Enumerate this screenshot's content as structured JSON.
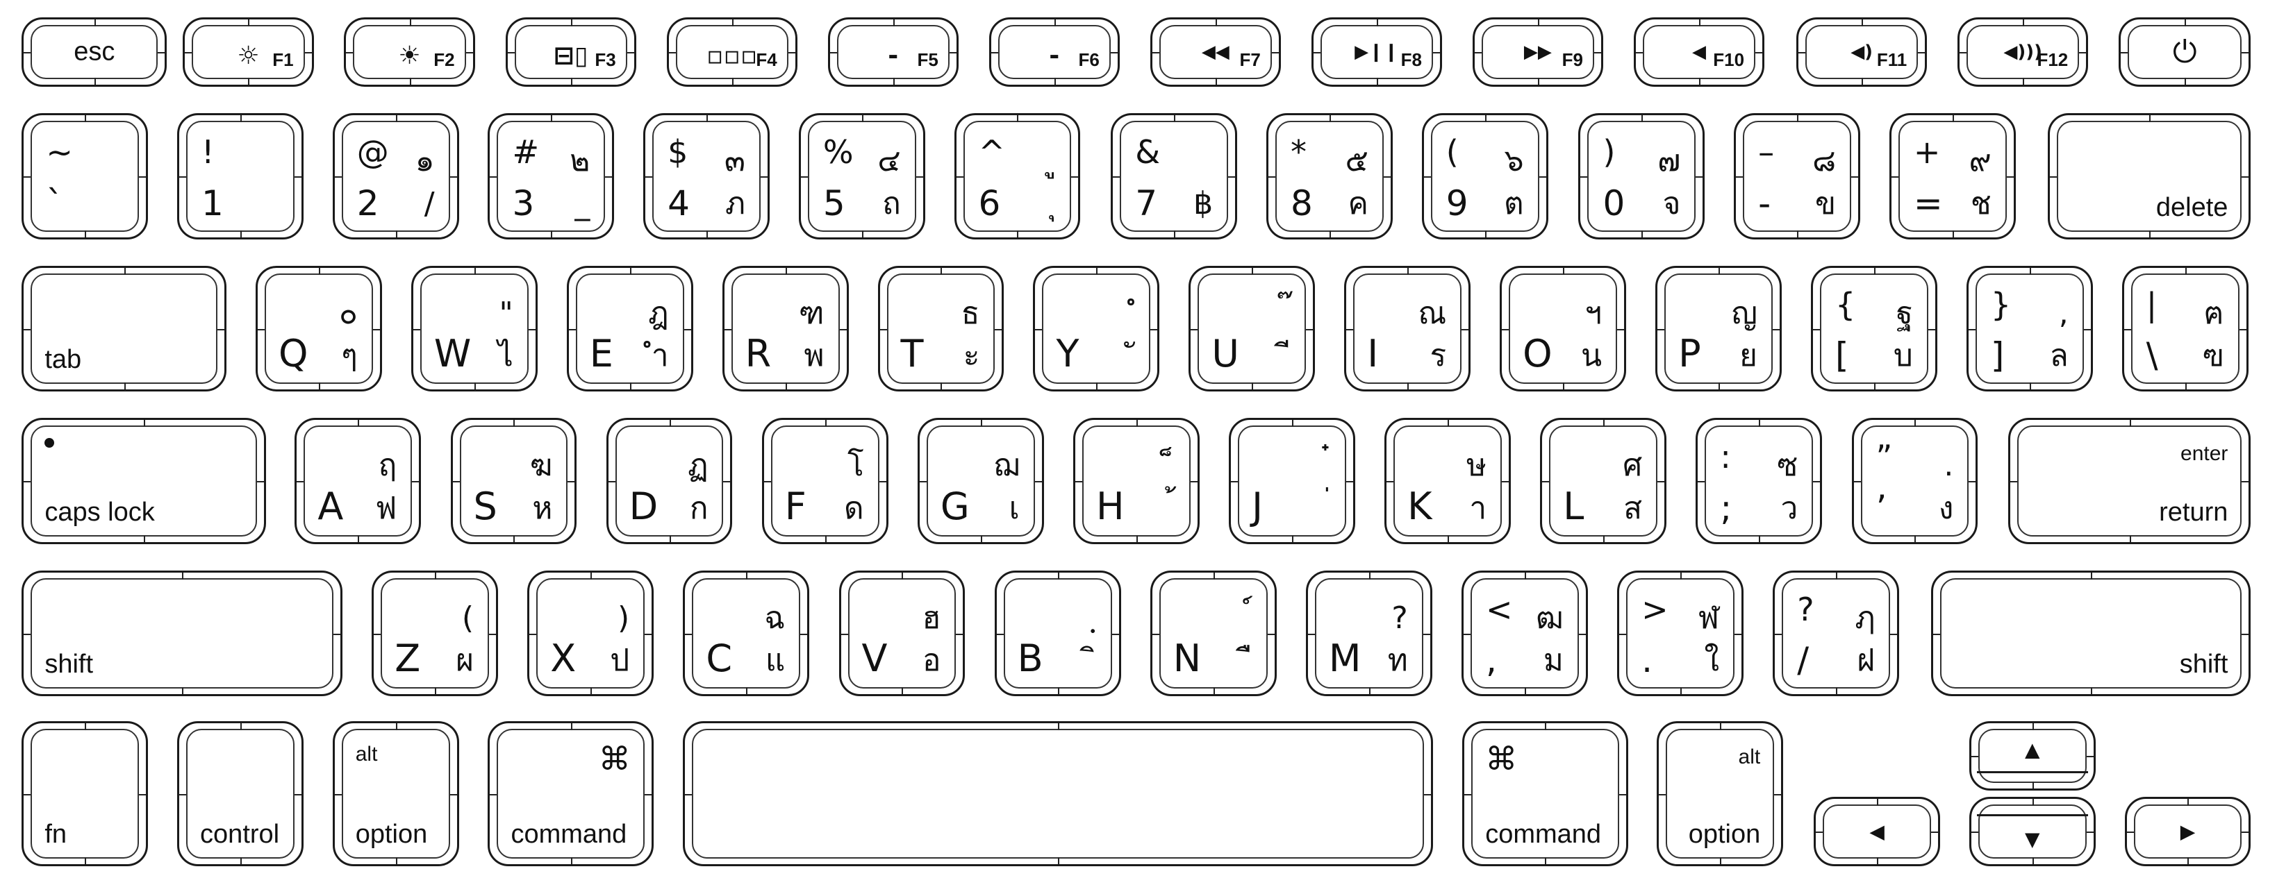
{
  "keyboard": {
    "layout_name": "Thai Kedmanee on Apple keyboard",
    "function_row": [
      {
        "id": "esc",
        "label": "esc"
      },
      {
        "id": "f1",
        "icon": "brightness-down-icon",
        "glyph": "☼",
        "fn": "F1"
      },
      {
        "id": "f2",
        "icon": "brightness-up-icon",
        "glyph": "☀",
        "fn": "F2"
      },
      {
        "id": "f3",
        "icon": "mission-control-icon",
        "glyph": "⊟▯",
        "fn": "F3"
      },
      {
        "id": "f4",
        "icon": "launchpad-grid-icon",
        "glyph": "▫▫▫",
        "fn": "F4"
      },
      {
        "id": "f5",
        "icon": "keyboard-backlight-down-icon",
        "glyph": "⁃",
        "fn": "F5"
      },
      {
        "id": "f6",
        "icon": "keyboard-backlight-up-icon",
        "glyph": "⁃",
        "fn": "F6"
      },
      {
        "id": "f7",
        "icon": "rewind-icon",
        "glyph": "◀◀",
        "fn": "F7"
      },
      {
        "id": "f8",
        "icon": "play-pause-icon",
        "glyph": "▶❙❙",
        "fn": "F8"
      },
      {
        "id": "f9",
        "icon": "fast-forward-icon",
        "glyph": "▶▶",
        "fn": "F9"
      },
      {
        "id": "f10",
        "icon": "mute-icon",
        "glyph": "◀",
        "fn": "F10"
      },
      {
        "id": "f11",
        "icon": "volume-down-icon",
        "glyph": "◀)",
        "fn": "F11"
      },
      {
        "id": "f12",
        "icon": "volume-up-icon",
        "glyph": "◀)))",
        "fn": "F12"
      },
      {
        "id": "power",
        "icon": "power-icon",
        "glyph": "⏻"
      }
    ],
    "number_row": [
      {
        "id": "grave",
        "shift": "~",
        "base": "`",
        "thai_shift": "",
        "thai_base": ""
      },
      {
        "id": "1",
        "shift": "!",
        "base": "1",
        "thai_shift": "",
        "thai_base": ""
      },
      {
        "id": "2",
        "shift": "@",
        "base": "2",
        "thai_shift": "๑",
        "thai_base": "/"
      },
      {
        "id": "3",
        "shift": "#",
        "base": "3",
        "thai_shift": "๒",
        "thai_base": "_"
      },
      {
        "id": "4",
        "shift": "$",
        "base": "4",
        "thai_shift": "๓",
        "thai_base": "ภ"
      },
      {
        "id": "5",
        "shift": "%",
        "base": "5",
        "thai_shift": "๔",
        "thai_base": "ถ"
      },
      {
        "id": "6",
        "shift": "^",
        "base": "6",
        "thai_shift": "ู",
        "thai_base": "ุ"
      },
      {
        "id": "7",
        "shift": "&",
        "base": "7",
        "thai_shift": "",
        "thai_base": "฿"
      },
      {
        "id": "8",
        "shift": "*",
        "base": "8",
        "thai_shift": "๕",
        "thai_base": "ค"
      },
      {
        "id": "9",
        "shift": "(",
        "base": "9",
        "thai_shift": "๖",
        "thai_base": "ต"
      },
      {
        "id": "0",
        "shift": ")",
        "base": "0",
        "thai_shift": "๗",
        "thai_base": "จ"
      },
      {
        "id": "minus",
        "shift": "–",
        "base": "-",
        "thai_shift": "๘",
        "thai_base": "ข"
      },
      {
        "id": "equal",
        "shift": "+",
        "base": "=",
        "thai_shift": "๙",
        "thai_base": "ช"
      },
      {
        "id": "delete",
        "label": "delete"
      }
    ],
    "top_row": [
      {
        "id": "tab",
        "label": "tab"
      },
      {
        "id": "q",
        "letter": "Q",
        "thai_shift": "๐",
        "thai_base": "ๆ"
      },
      {
        "id": "w",
        "letter": "W",
        "thai_shift": "\"",
        "thai_base": "ไ"
      },
      {
        "id": "e",
        "letter": "E",
        "thai_shift": "ฎ",
        "thai_base": "ำ"
      },
      {
        "id": "r",
        "letter": "R",
        "thai_shift": "ฑ",
        "thai_base": "พ"
      },
      {
        "id": "t",
        "letter": "T",
        "thai_shift": "ธ",
        "thai_base": "ะ"
      },
      {
        "id": "y",
        "letter": "Y",
        "thai_shift": "ํ",
        "thai_base": "ั"
      },
      {
        "id": "u",
        "letter": "U",
        "thai_shift": "๊",
        "thai_base": "ี"
      },
      {
        "id": "i",
        "letter": "I",
        "thai_shift": "ณ",
        "thai_base": "ร"
      },
      {
        "id": "o",
        "letter": "O",
        "thai_shift": "ฯ",
        "thai_base": "น"
      },
      {
        "id": "p",
        "letter": "P",
        "thai_shift": "ญ",
        "thai_base": "ย"
      },
      {
        "id": "lbracket",
        "shift": "{",
        "base": "[",
        "thai_shift": "ฐ",
        "thai_base": "บ"
      },
      {
        "id": "rbracket",
        "shift": "}",
        "base": "]",
        "thai_shift": ",",
        "thai_base": "ล"
      },
      {
        "id": "backslash",
        "shift": "|",
        "base": "\\",
        "thai_shift": "ฅ",
        "thai_base": "ฃ"
      }
    ],
    "home_row": [
      {
        "id": "capslock",
        "label": "caps lock"
      },
      {
        "id": "a",
        "letter": "A",
        "thai_shift": "ฤ",
        "thai_base": "ฟ"
      },
      {
        "id": "s",
        "letter": "S",
        "thai_shift": "ฆ",
        "thai_base": "ห"
      },
      {
        "id": "d",
        "letter": "D",
        "thai_shift": "ฏ",
        "thai_base": "ก"
      },
      {
        "id": "f",
        "letter": "F",
        "thai_shift": "โ",
        "thai_base": "ด"
      },
      {
        "id": "g",
        "letter": "G",
        "thai_shift": "ฌ",
        "thai_base": "เ"
      },
      {
        "id": "h",
        "letter": "H",
        "thai_shift": "็",
        "thai_base": "้"
      },
      {
        "id": "j",
        "letter": "J",
        "thai_shift": "๋",
        "thai_base": "่"
      },
      {
        "id": "k",
        "letter": "K",
        "thai_shift": "ษ",
        "thai_base": "า"
      },
      {
        "id": "l",
        "letter": "L",
        "thai_shift": "ศ",
        "thai_base": "ส"
      },
      {
        "id": "semicolon",
        "shift": ":",
        "base": ";",
        "thai_shift": "ซ",
        "thai_base": "ว"
      },
      {
        "id": "quote",
        "shift": "”",
        "base": "’",
        "thai_shift": ".",
        "thai_base": "ง"
      },
      {
        "id": "return",
        "label": "return",
        "sublabel": "enter"
      }
    ],
    "bottom_row": [
      {
        "id": "lshift",
        "label": "shift"
      },
      {
        "id": "z",
        "letter": "Z",
        "thai_shift": "(",
        "thai_base": "ผ"
      },
      {
        "id": "x",
        "letter": "X",
        "thai_shift": ")",
        "thai_base": "ป"
      },
      {
        "id": "c",
        "letter": "C",
        "thai_shift": "ฉ",
        "thai_base": "แ"
      },
      {
        "id": "v",
        "letter": "V",
        "thai_shift": "ฮ",
        "thai_base": "อ"
      },
      {
        "id": "b",
        "letter": "B",
        "thai_shift": "ฺ",
        "thai_base": "ิ"
      },
      {
        "id": "n",
        "letter": "N",
        "thai_shift": "์",
        "thai_base": "ื"
      },
      {
        "id": "m",
        "letter": "M",
        "thai_shift": "?",
        "thai_base": "ท"
      },
      {
        "id": "comma",
        "shift": "<",
        "base": ",",
        "thai_shift": "ฒ",
        "thai_base": "ม"
      },
      {
        "id": "period",
        "shift": ">",
        "base": ".",
        "thai_shift": "ฬ",
        "thai_base": "ใ"
      },
      {
        "id": "slash",
        "shift": "?",
        "base": "/",
        "thai_shift": "ฦ",
        "thai_base": "ฝ"
      },
      {
        "id": "rshift",
        "label": "shift"
      }
    ],
    "modifier_row": [
      {
        "id": "fn",
        "label": "fn"
      },
      {
        "id": "control",
        "label": "control"
      },
      {
        "id": "loption",
        "label": "option",
        "sublabel": "alt"
      },
      {
        "id": "lcommand",
        "label": "command",
        "symbol": "⌘"
      },
      {
        "id": "space",
        "label": ""
      },
      {
        "id": "rcommand",
        "label": "command",
        "symbol": "⌘"
      },
      {
        "id": "roption",
        "label": "option",
        "sublabel": "alt"
      },
      {
        "id": "left",
        "icon": "arrow-left-icon",
        "glyph": "◀"
      },
      {
        "id": "up",
        "icon": "arrow-up-icon",
        "glyph": "▲"
      },
      {
        "id": "down",
        "icon": "arrow-down-icon",
        "glyph": "▼"
      },
      {
        "id": "right",
        "icon": "arrow-right-icon",
        "glyph": "▶"
      }
    ]
  }
}
